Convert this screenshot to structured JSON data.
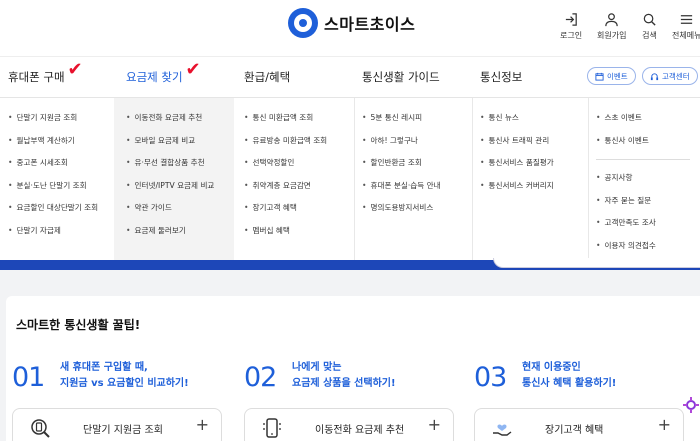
{
  "logo": {
    "text": "스마트초이스"
  },
  "utils": [
    {
      "label": "로그인",
      "icon": "login-icon"
    },
    {
      "label": "회원가입",
      "icon": "user-icon"
    },
    {
      "label": "검색",
      "icon": "search-icon"
    },
    {
      "label": "전체메뉴",
      "icon": "menu-icon"
    }
  ],
  "nav": {
    "items": [
      "휴대폰 구매",
      "요금제 찾기",
      "환급/혜택",
      "통신생활 가이드",
      "통신정보"
    ],
    "active_index": 1,
    "check_mark": "✔",
    "event_chip": "이벤트",
    "support_chip": "고객센터"
  },
  "mega": {
    "col1": [
      "단말기 지원금 조회",
      "월납부액 계산하기",
      "중고폰 시세조회",
      "분실·도난 단말기 조회",
      "요금할인 대상단말기 조회",
      "단말기 자급제"
    ],
    "col2": [
      "이동전화 요금제 추천",
      "모바일 요금제 비교",
      "유·무선 결합상품 추천",
      "인터넷/IPTV 요금제 비교",
      "약관 가이드",
      "요금제 둘러보기"
    ],
    "col3": [
      "통신 미환급액 조회",
      "유료방송 미환급액 조회",
      "선택약정할인",
      "취약계층 요금감면",
      "장기고객 혜택",
      "멤버십 혜택"
    ],
    "col4": [
      "5분 통신 레시피",
      "아하! 그렇구나",
      "할인반환금 조회",
      "휴대폰 분실·습득 안내",
      "명의도용방지서비스"
    ],
    "col5": [
      "통신 뉴스",
      "통신사 트래픽 관리",
      "통신서비스 품질평가",
      "통신서비스 커버리지"
    ],
    "col6a": [
      "스초 이벤트",
      "통신사 이벤트"
    ],
    "col6b": [
      "공지사항",
      "자주 묻는 질문",
      "고객만족도 조사",
      "이용자 의견접수"
    ]
  },
  "content": {
    "title": "스마트한 통신생활 꿀팁!",
    "tips": [
      {
        "num": "01",
        "line1": "새 휴대폰 구입할 때,",
        "line2": "지원금 vs 요금할인 비교하기!"
      },
      {
        "num": "02",
        "line1": "나에게 맞는",
        "line2": "요금제 상품을 선택하기!"
      },
      {
        "num": "03",
        "line1": "현재 이용중인",
        "line2": "통신사 혜택 활용하기!"
      }
    ],
    "tiles": [
      {
        "label": "단말기 지원금 조회",
        "icon": "magnifier-phone-icon"
      },
      {
        "label": "이동전화 요금제 추천",
        "icon": "phone-icon"
      },
      {
        "label": "장기고객 혜택",
        "icon": "hand-heart-icon"
      }
    ],
    "plus": "+"
  },
  "colors": {
    "brand": "#1e5fd9",
    "band": "#1d47b8",
    "check": "#e8112d"
  }
}
